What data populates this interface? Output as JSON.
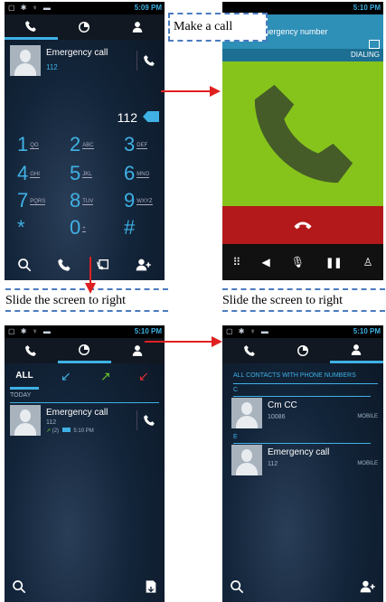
{
  "screen1": {
    "status_time": "5:09 PM",
    "contact_name": "Emergency call",
    "contact_number": "112",
    "dial_input": "112",
    "keys": [
      {
        "d": "1",
        "l": "QO"
      },
      {
        "d": "2",
        "l": "ABC"
      },
      {
        "d": "3",
        "l": "DEF"
      },
      {
        "d": "4",
        "l": "GHI"
      },
      {
        "d": "5",
        "l": "JKL"
      },
      {
        "d": "6",
        "l": "MNO"
      },
      {
        "d": "7",
        "l": "PQRS"
      },
      {
        "d": "8",
        "l": "TUV"
      },
      {
        "d": "9",
        "l": "WXYZ"
      },
      {
        "d": "*",
        "l": ""
      },
      {
        "d": "0",
        "l": "+"
      },
      {
        "d": "#",
        "l": ""
      }
    ]
  },
  "screen2": {
    "status_time": "5:10 PM",
    "title": "Emergency number",
    "state": "DIALING"
  },
  "screen3": {
    "status_time": "5:10 PM",
    "filter_all": "ALL",
    "section": "TODAY",
    "contact_name": "Emergency call",
    "contact_number": "112",
    "call_count": "(2)",
    "call_time": "5:10 PM"
  },
  "screen4": {
    "status_time": "5:10 PM",
    "header": "ALL CONTACTS WITH PHONE NUMBERS",
    "groups": [
      {
        "letter": "C",
        "name": "Cm CC",
        "number": "10086",
        "type": "MOBILE"
      },
      {
        "letter": "E",
        "name": "Emergency call",
        "number": "112",
        "type": "MOBILE"
      }
    ]
  },
  "captions": {
    "make_call": "Make a call",
    "slide_left": "Slide the screen to right",
    "slide_right": "Slide the screen to right"
  },
  "colors": {
    "accent": "#3fb1e5",
    "arrow": "#e02020",
    "green": "#84c21b",
    "red": "#b01818"
  }
}
